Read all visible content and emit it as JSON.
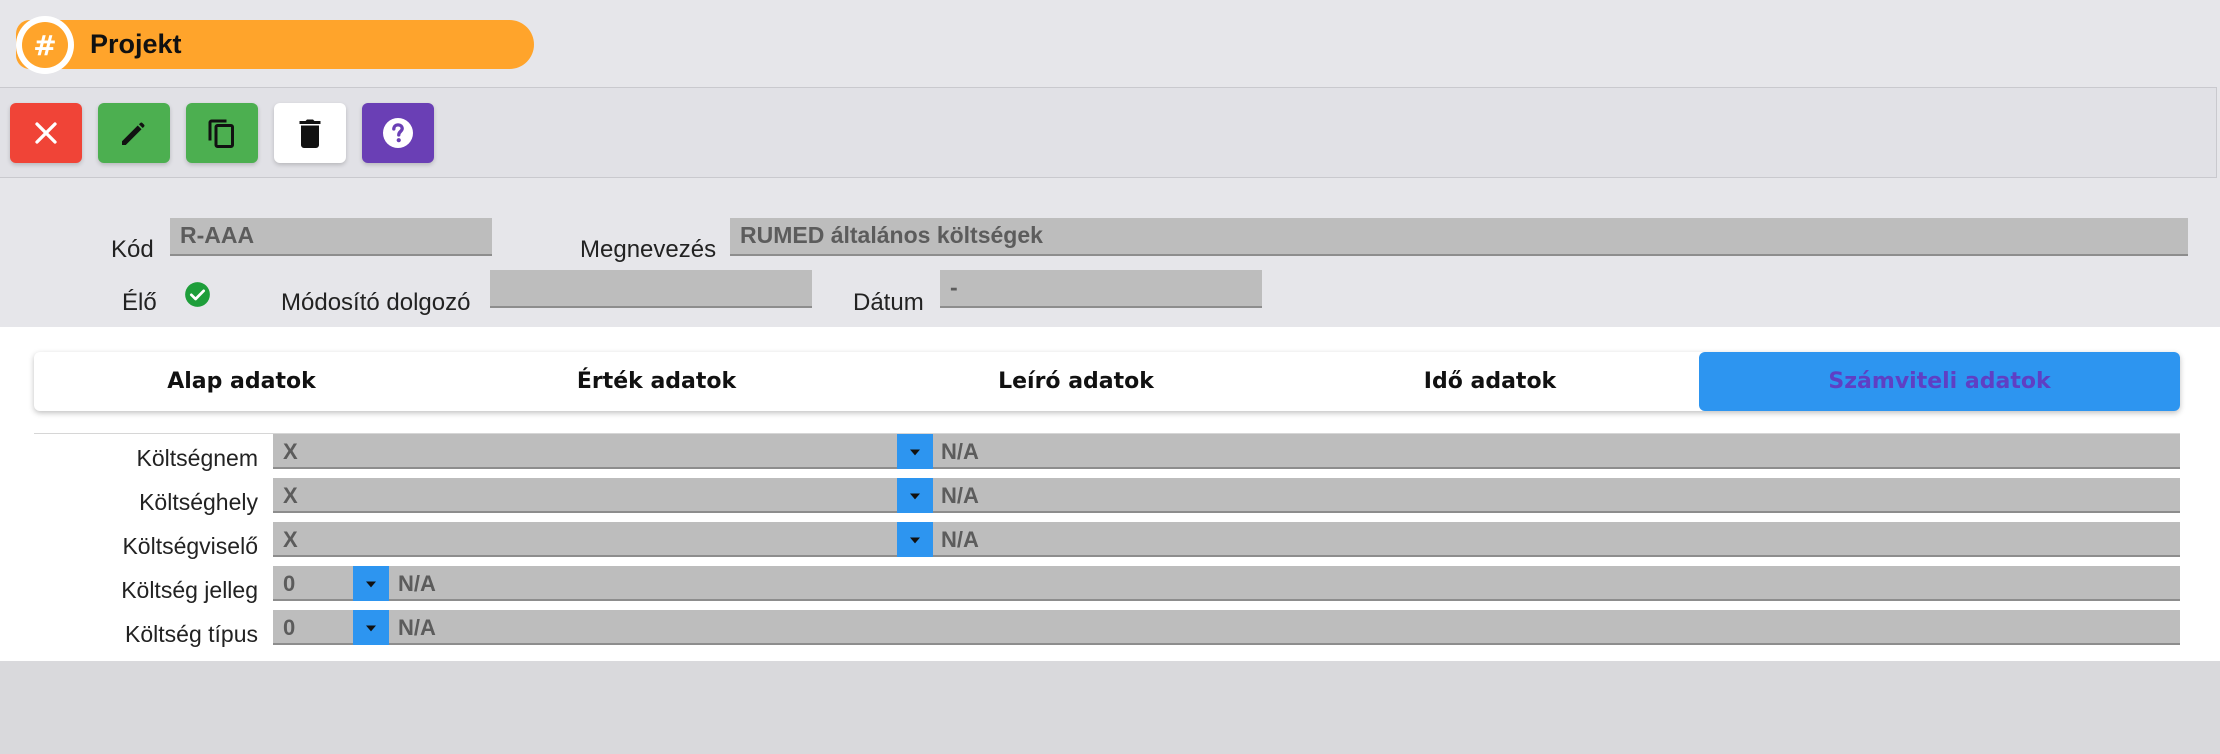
{
  "header": {
    "title": "Projekt",
    "title_icon": "hash-icon",
    "icon_glyph": "#"
  },
  "toolbar": {
    "buttons": [
      {
        "name": "close-button",
        "icon": "close-icon",
        "color": "#f04437"
      },
      {
        "name": "edit-button",
        "icon": "pencil-icon",
        "color": "#4caf50"
      },
      {
        "name": "copy-button",
        "icon": "copy-icon",
        "color": "#4caf50"
      },
      {
        "name": "delete-button",
        "icon": "trash-icon",
        "color": "#ffffff"
      },
      {
        "name": "help-button",
        "icon": "help-icon",
        "color": "#6a3fb5"
      }
    ]
  },
  "form": {
    "kod_label": "Kód",
    "kod_value": "R-AAA",
    "megnevezes_label": "Megnevezés",
    "megnevezes_value": "RUMED általános költségek",
    "elo_label": "Élő",
    "elo_checked": true,
    "modosito_label": "Módosító dolgozó",
    "modosito_value": "",
    "datum_label": "Dátum",
    "datum_value": "-"
  },
  "tabs": [
    {
      "label": "Alap adatok",
      "active": false
    },
    {
      "label": "Érték adatok",
      "active": false
    },
    {
      "label": "Leíró adatok",
      "active": false
    },
    {
      "label": "Idő adatok",
      "active": false
    },
    {
      "label": "Számviteli adatok",
      "active": true
    }
  ],
  "accounting": {
    "rows": [
      {
        "label": "Költségnem",
        "code": "X",
        "desc": "N/A"
      },
      {
        "label": "Költséghely",
        "code": "X",
        "desc": "N/A"
      },
      {
        "label": "Költségviselő",
        "code": "X",
        "desc": "N/A"
      },
      {
        "label": "Költség jelleg",
        "code": "0",
        "desc": "N/A"
      },
      {
        "label": "Költség típus",
        "code": "0",
        "desc": "N/A"
      }
    ]
  },
  "colors": {
    "accent_orange": "#ffa42b",
    "accent_blue": "#2d95f0",
    "active_tab_text": "#5f3fc4",
    "check_green": "#1e9e3a"
  }
}
